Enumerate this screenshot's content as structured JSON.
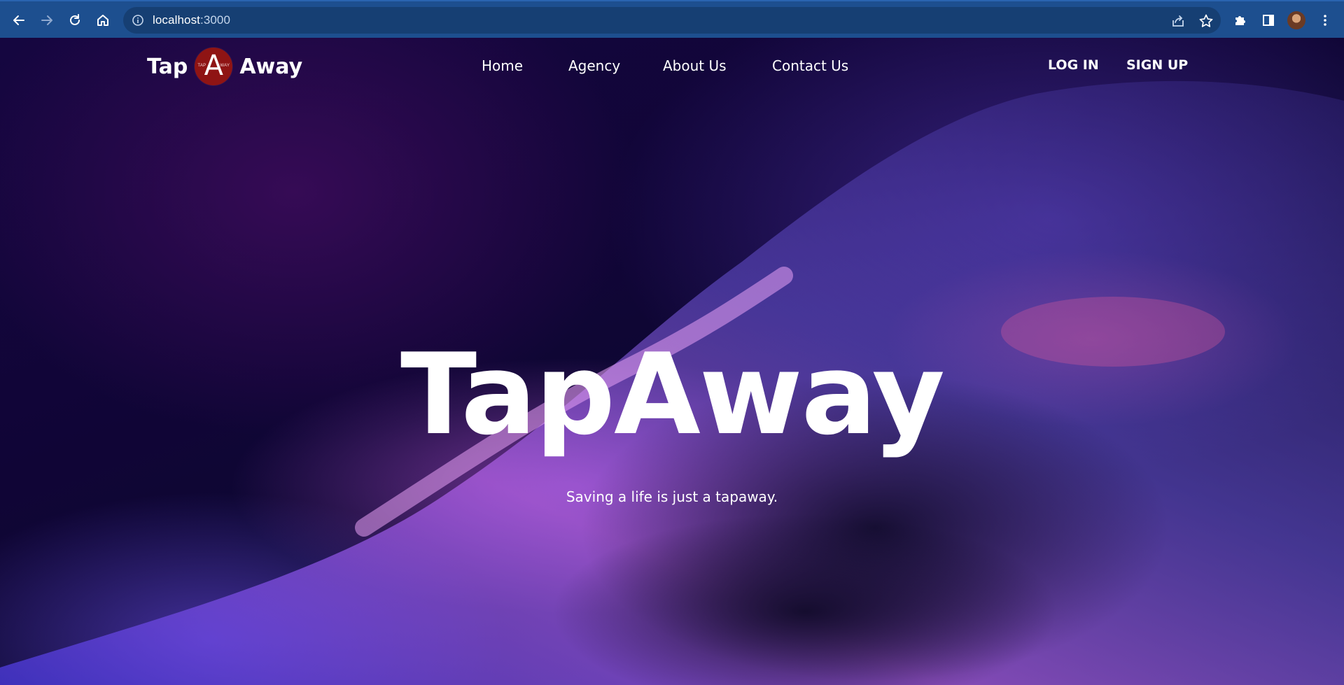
{
  "browser": {
    "url_host": "localhost",
    "url_port": ":3000",
    "icons": {
      "back": "arrow-left-icon",
      "forward": "arrow-right-icon",
      "reload": "reload-icon",
      "home": "home-icon",
      "site_info": "info-icon",
      "share": "share-icon",
      "bookmark": "star-icon",
      "extensions": "puzzle-icon",
      "side_panel": "side-panel-icon",
      "profile": "avatar",
      "menu": "kebab-menu-icon"
    },
    "chrome_color": "#1d4f8f"
  },
  "navbar": {
    "brand_left": "Tap",
    "brand_right": "Away",
    "logo_letter": "A",
    "logo_small_left": "TAP",
    "logo_small_right": "WAY",
    "logo_color": "#8f1414",
    "links": [
      "Home",
      "Agency",
      "About Us",
      "Contact Us"
    ],
    "login_label": "LOG IN",
    "signup_label": "SIGN UP"
  },
  "hero": {
    "title": "TapAway",
    "subtitle": "Saving a life is just a tapaway."
  }
}
